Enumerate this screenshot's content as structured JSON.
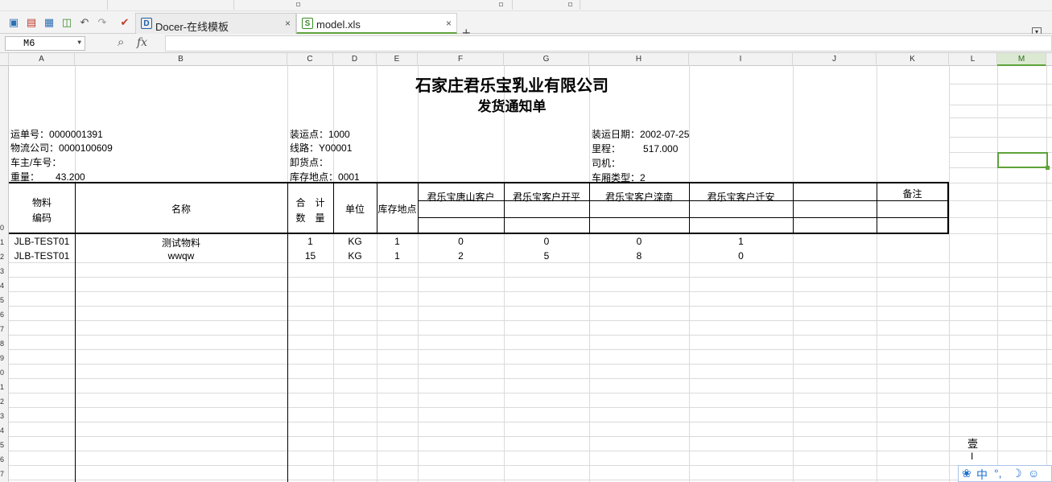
{
  "tabs": [
    {
      "label": "Docer-在线模板",
      "icon": "docer-icon",
      "close": "×"
    },
    {
      "label": "model.xls",
      "icon": "spreadsheet-icon",
      "close": "×"
    }
  ],
  "new_tab": "+",
  "formula_bar": {
    "cell_ref": "M6",
    "fx": "fx",
    "value": ""
  },
  "columns": [
    "A",
    "B",
    "C",
    "D",
    "E",
    "F",
    "G",
    "H",
    "I",
    "J",
    "K",
    "L",
    "M"
  ],
  "selected_column": "M",
  "row_numbers": [
    "0",
    "1",
    "2",
    "3",
    "4",
    "5",
    "6",
    "7",
    "8",
    "9",
    "0",
    "1",
    "2",
    "3",
    "4",
    "5",
    "6",
    "7"
  ],
  "report": {
    "company": "石家庄君乐宝乳业有限公司",
    "doc_title": "发货通知单",
    "left_info": [
      {
        "label": "运单号：",
        "value": "0000001391"
      },
      {
        "label": "物流公司：",
        "value": "0000100609"
      },
      {
        "label": "车主/车号：",
        "value": ""
      },
      {
        "label": "重量：",
        "value": "43.200"
      }
    ],
    "mid_info": [
      {
        "label": "装运点：",
        "value": "1000"
      },
      {
        "label": "线路：",
        "value": "Y00001"
      },
      {
        "label": "卸货点：",
        "value": ""
      },
      {
        "label": "库存地点：",
        "value": "0001"
      }
    ],
    "right_info": [
      {
        "label": "装运日期：",
        "value": "2002-07-25"
      },
      {
        "label": "里程：",
        "value": "517.000"
      },
      {
        "label": "司机：",
        "value": ""
      },
      {
        "label": "车厢类型：",
        "value": "2"
      }
    ],
    "headers": {
      "material_code_1": "物料",
      "material_code_2": "编码",
      "name": "名称",
      "total_1": "合　计",
      "total_2": "数　量",
      "unit": "单位",
      "storage": "库存地点",
      "customers": [
        "君乐宝唐山客户",
        "君乐宝客户开平",
        "君乐宝客户滦南",
        "君乐宝客户迁安"
      ],
      "remark": "备注"
    },
    "rows": [
      {
        "code": "JLB-TEST01",
        "name": "测试物料",
        "qty": "1",
        "unit": "KG",
        "storage": "1",
        "c1": "0",
        "c2": "0",
        "c3": "0",
        "c4": "1"
      },
      {
        "code": "JLB-TEST01",
        "name": "wwqw",
        "qty": "15",
        "unit": "KG",
        "storage": "1",
        "c1": "2",
        "c2": "5",
        "c3": "8",
        "c4": "0"
      }
    ]
  },
  "side_text": {
    "char1": "壹",
    "char2": "I"
  },
  "ime": {
    "lang": "中",
    "punct": "°,",
    "moon": "☽",
    "face": "☺"
  }
}
